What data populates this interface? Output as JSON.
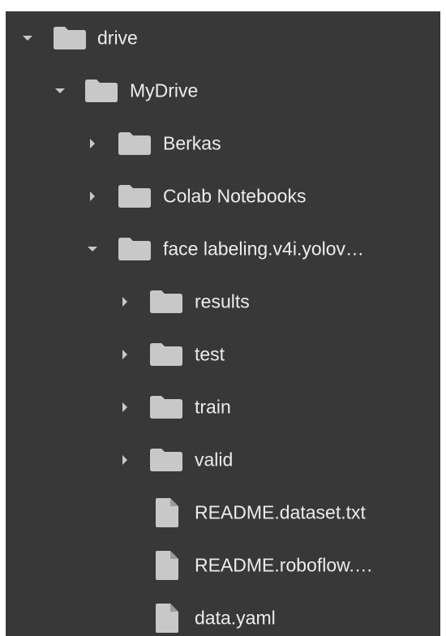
{
  "file_tree": {
    "items": [
      {
        "label": "drive",
        "type": "folder",
        "expanded": true,
        "depth": 0
      },
      {
        "label": "MyDrive",
        "type": "folder",
        "expanded": true,
        "depth": 1
      },
      {
        "label": "Berkas",
        "type": "folder",
        "expanded": false,
        "depth": 2
      },
      {
        "label": "Colab Notebooks",
        "type": "folder",
        "expanded": false,
        "depth": 2
      },
      {
        "label": "face labeling.v4i.yolov…",
        "type": "folder",
        "expanded": true,
        "depth": 2
      },
      {
        "label": "results",
        "type": "folder",
        "expanded": false,
        "depth": 3
      },
      {
        "label": "test",
        "type": "folder",
        "expanded": false,
        "depth": 3
      },
      {
        "label": "train",
        "type": "folder",
        "expanded": false,
        "depth": 3
      },
      {
        "label": "valid",
        "type": "folder",
        "expanded": false,
        "depth": 3
      },
      {
        "label": "README.dataset.txt",
        "type": "file",
        "depth": 3
      },
      {
        "label": "README.roboflow.…",
        "type": "file",
        "depth": 3
      },
      {
        "label": "data.yaml",
        "type": "file",
        "depth": 3
      }
    ]
  },
  "colors": {
    "panel_background": "#383838",
    "text": "#ececec",
    "icon": "#c8c8c8"
  },
  "icons": {
    "folder": "folder-icon",
    "file": "file-icon",
    "expanded": "caret-down-icon",
    "collapsed": "caret-right-icon"
  }
}
